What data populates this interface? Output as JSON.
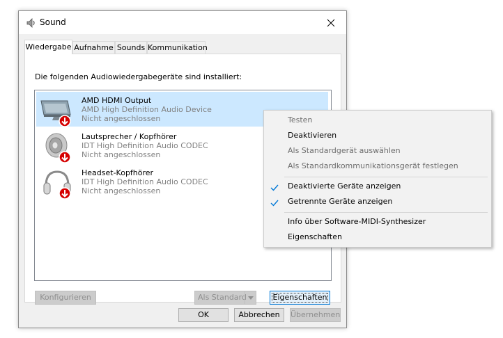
{
  "window": {
    "title": "Sound",
    "tabs": [
      {
        "label": "Wiedergabe",
        "active": true
      },
      {
        "label": "Aufnahme"
      },
      {
        "label": "Sounds"
      },
      {
        "label": "Kommunikation"
      }
    ],
    "panel_label": "Die folgenden Audiowiedergabegeräte sind installiert:",
    "devices": [
      {
        "name": "AMD HDMI Output",
        "description": "AMD High Definition Audio Device",
        "status": "Nicht angeschlossen",
        "icon": "monitor-icon",
        "selected": true
      },
      {
        "name": "Lautsprecher / Kopfhörer",
        "description": "IDT High Definition Audio CODEC",
        "status": "Nicht angeschlossen",
        "icon": "speaker-icon"
      },
      {
        "name": "Headset-Kopfhörer",
        "description": "IDT High Definition Audio CODEC",
        "status": "Nicht angeschlossen",
        "icon": "headphones-icon"
      }
    ],
    "buttons": {
      "configure": "Konfigurieren",
      "set_default": "Als Standard",
      "properties": "Eigenschaften",
      "ok": "OK",
      "cancel": "Abbrechen",
      "apply": "Übernehmen"
    }
  },
  "context_menu": {
    "items": [
      {
        "label": "Testen",
        "disabled": true
      },
      {
        "label": "Deaktivieren"
      },
      {
        "label": "Als Standardgerät auswählen",
        "disabled": true
      },
      {
        "label": "Als Standardkommunikationsgerät festlegen",
        "disabled": true
      },
      {
        "label": "Deaktivierte Geräte anzeigen",
        "checked": true
      },
      {
        "label": "Getrennte Geräte anzeigen",
        "checked": true
      },
      {
        "label": "Info über Software-MIDI-Synthesizer"
      },
      {
        "label": "Eigenschaften"
      }
    ]
  },
  "colors": {
    "selection": "#cce8ff",
    "accent": "#0078d7",
    "disconnected_badge": "#d50000"
  }
}
